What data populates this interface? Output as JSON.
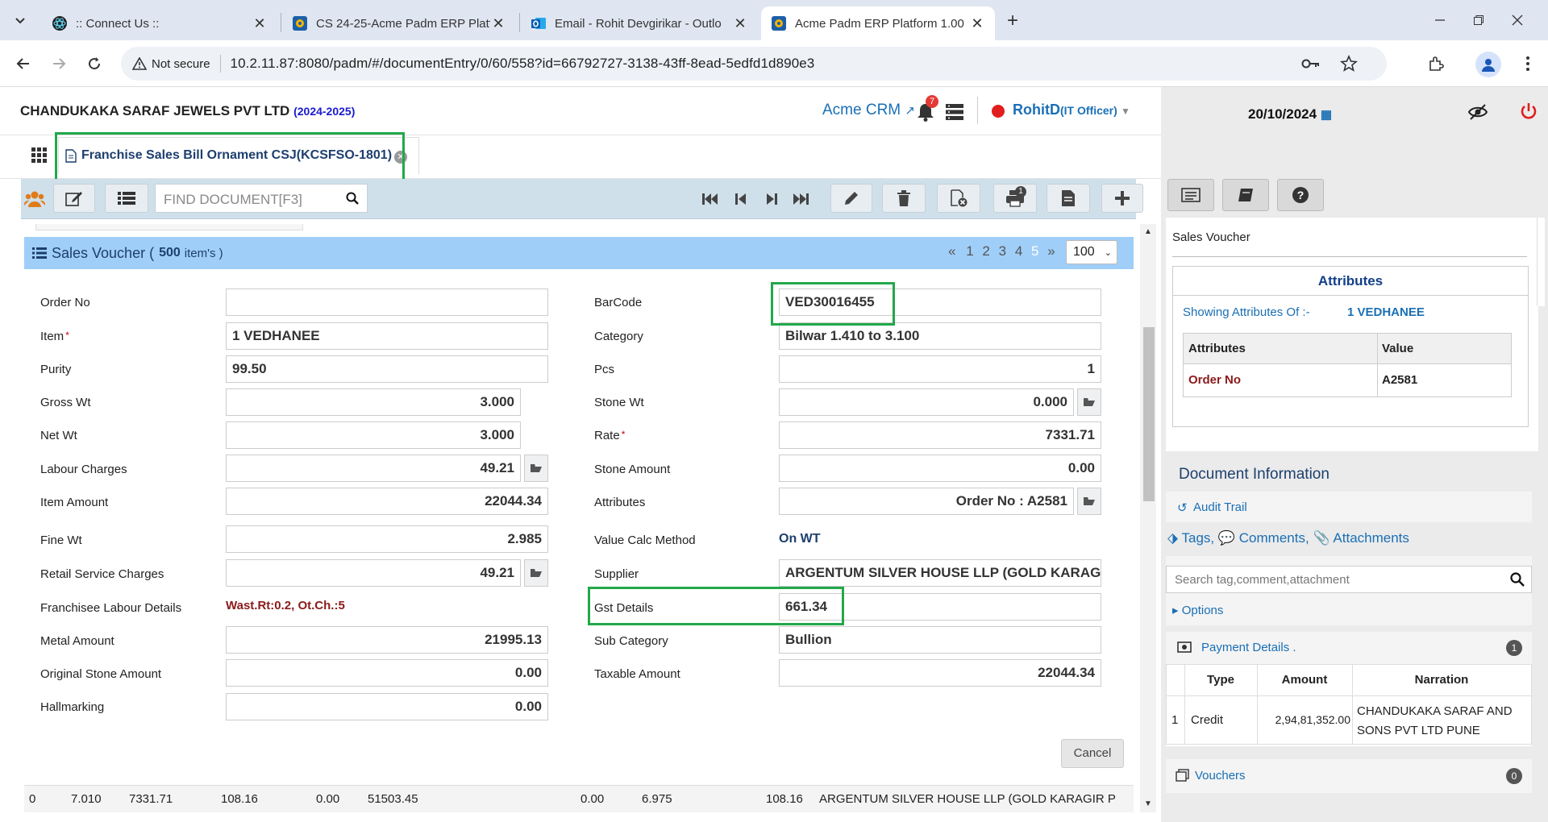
{
  "browser": {
    "tabs": [
      {
        "title": ":: Connect Us ::"
      },
      {
        "title": "CS 24-25-Acme Padm ERP Platf"
      },
      {
        "title": "Email - Rohit Devgirikar - Outlo"
      },
      {
        "title": "Acme Padm ERP Platform 1.00"
      }
    ],
    "security_label": "Not secure",
    "url": "10.2.11.87:8080/padm/#/documentEntry/0/60/558?id=66792727-3138-43ff-8ead-5edfd1d890e3"
  },
  "header": {
    "company": "CHANDUKAKA SARAF JEWELS PVT LTD",
    "year": "(2024-2025)",
    "crm_link": "Acme CRM",
    "notif_count": "7",
    "user": "RohitD",
    "role": "(IT Officer)",
    "date": "20/10/2024"
  },
  "doc_tab": {
    "label": "Franchise Sales Bill Ornament CSJ(KCSFSO-1801)"
  },
  "toolbar": {
    "find_placeholder": "FIND DOCUMENT[F3]",
    "print_badge": "1"
  },
  "voucher": {
    "title": "Sales Voucher (",
    "count": "500",
    "suffix": "item's )",
    "pagination": {
      "prev": "«",
      "pages": [
        "1",
        "2",
        "3",
        "4",
        "5"
      ],
      "next": "»",
      "page_size": "100"
    }
  },
  "form": {
    "left": [
      {
        "label": "Order No",
        "value": ""
      },
      {
        "label": "Item",
        "value": "1 VEDHANEE"
      },
      {
        "label": "Purity",
        "value": "99.50"
      },
      {
        "label": "Gross Wt",
        "value": "3.000"
      },
      {
        "label": "Net Wt",
        "value": "3.000"
      },
      {
        "label": "Labour Charges",
        "value": "49.21"
      },
      {
        "label": "Item Amount",
        "value": "22044.34"
      },
      {
        "label": "Fine Wt",
        "value": "2.985"
      },
      {
        "label": "Retail Service Charges",
        "value": "49.21"
      },
      {
        "label": "Franchisee Labour Details",
        "value": "Wast.Rt:0.2, Ot.Ch.:5"
      },
      {
        "label": "Metal Amount",
        "value": "21995.13"
      },
      {
        "label": "Original Stone Amount",
        "value": "0.00"
      },
      {
        "label": "Hallmarking",
        "value": "0.00"
      }
    ],
    "right": [
      {
        "label": "BarCode",
        "value": "VED30016455"
      },
      {
        "label": "Category",
        "value": "Bilwar 1.410 to 3.100"
      },
      {
        "label": "Pcs",
        "value": "1"
      },
      {
        "label": "Stone Wt",
        "value": "0.000"
      },
      {
        "label": "Rate",
        "value": "7331.71"
      },
      {
        "label": "Stone Amount",
        "value": "0.00"
      },
      {
        "label": "Attributes",
        "value": "Order No : A2581"
      },
      {
        "label": "Value Calc Method",
        "value": "On WT"
      },
      {
        "label": "Supplier",
        "value": "ARGENTUM SILVER HOUSE LLP (GOLD KARAGIR PVT LTD)"
      },
      {
        "label": "Gst Details",
        "value": "661.34"
      },
      {
        "label": "Sub Category",
        "value": "Bullion"
      },
      {
        "label": "Taxable Amount",
        "value": "22044.34"
      }
    ],
    "cancel_label": "Cancel"
  },
  "grid_row": [
    "0",
    "7.010",
    "7331.71",
    "108.16",
    "0.00",
    "51503.45",
    "0.00",
    "6.975",
    "108.16",
    "ARGENTUM SILVER HOUSE LLP (GOLD KARAGIR P"
  ],
  "right_panel": {
    "section_title": "Sales Voucher",
    "attributes": {
      "title": "Attributes",
      "showing_label": "Showing Attributes Of :-",
      "showing_item": "1 VEDHANEE",
      "col_attr": "Attributes",
      "col_value": "Value",
      "rows": [
        {
          "attr": "Order No",
          "value": "A2581"
        }
      ]
    },
    "doc_info": {
      "title": "Document Information",
      "audit_trail": "Audit Trail",
      "tags": "Tags,",
      "comments": "Comments,",
      "attachments": "Attachments",
      "search_placeholder": "Search tag,comment,attachment",
      "options": "Options",
      "payment_title": "Payment Details .",
      "payment_count": "1",
      "payment_cols": [
        "Type",
        "Amount",
        "Narration"
      ],
      "payment_rows": [
        {
          "idx": "1",
          "type": "Credit",
          "amount": "2,94,81,352.00",
          "narration": "CHANDUKAKA SARAF AND SONS PVT LTD PUNE"
        }
      ],
      "vouchers": "Vouchers",
      "vouchers_count": "0"
    }
  },
  "colors": {
    "accent": "#1a6fb5",
    "banner": "#9fcef8",
    "highlight": "#22a84a",
    "dark_red": "#8b1a1a"
  }
}
